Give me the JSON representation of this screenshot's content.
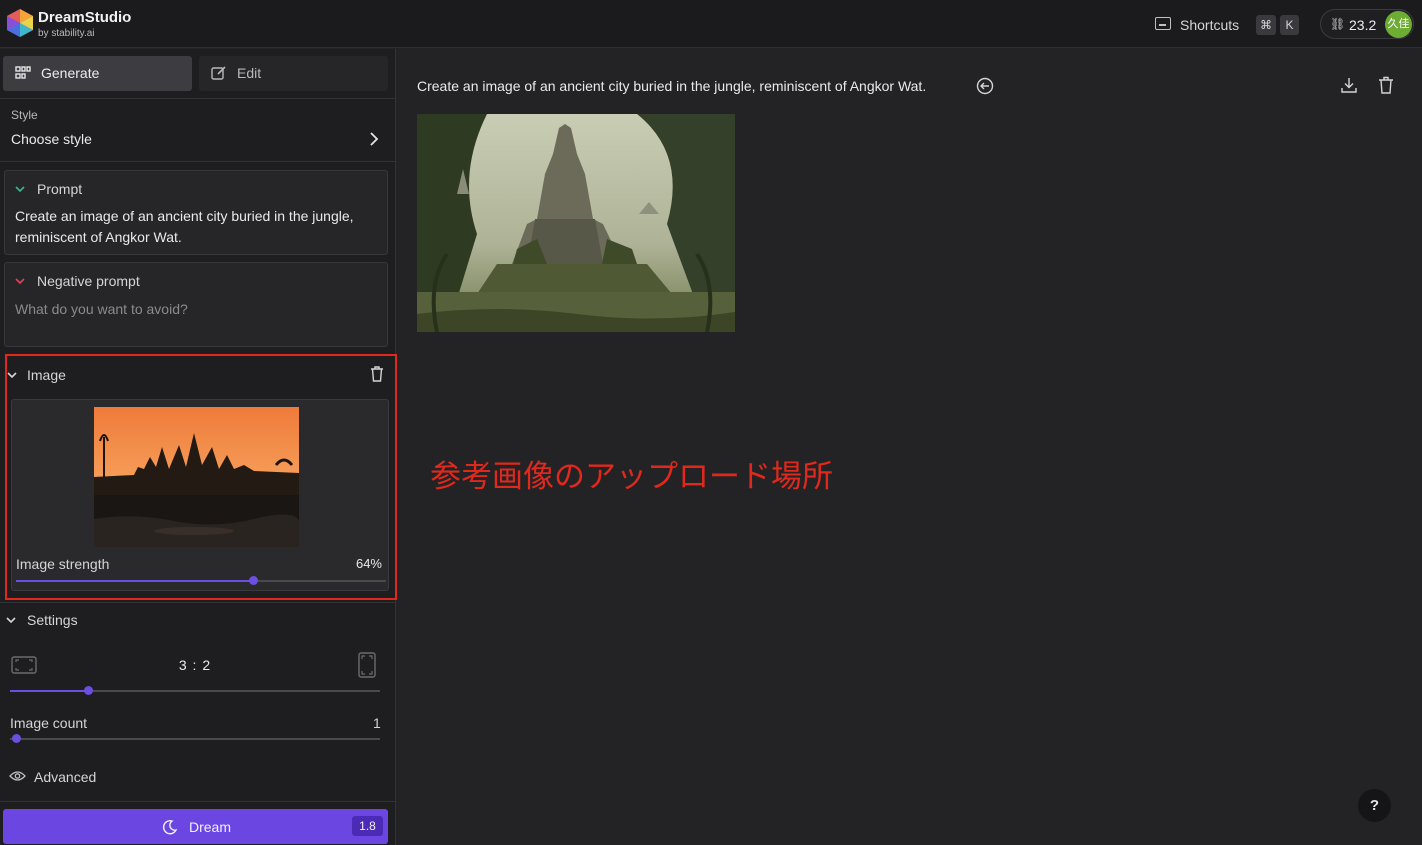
{
  "app": {
    "name": "DreamStudio",
    "subtitle": "by stability.ai"
  },
  "header": {
    "keyboard_icon": "keyboard-icon",
    "shortcuts_label": "Shortcuts",
    "shortcut_keys": [
      "⌘",
      "K"
    ],
    "credits_icon": "credits-icon",
    "credits": "23.2",
    "avatar_text": "久佳"
  },
  "sidebar": {
    "tabs": [
      {
        "label": "Generate",
        "icon": "grid-icon",
        "active": true
      },
      {
        "label": "Edit",
        "icon": "edit-icon",
        "active": false
      }
    ],
    "style": {
      "label": "Style",
      "value": "Choose style"
    },
    "prompt": {
      "title": "Prompt",
      "text": "Create an image of an ancient city buried in the jungle, reminiscent of Angkor Wat."
    },
    "negative_prompt": {
      "title": "Negative prompt",
      "placeholder": "What do you want to avoid?"
    },
    "image": {
      "title": "Image",
      "strength_label": "Image strength",
      "strength_value": "64%",
      "strength_fraction": 0.64
    },
    "settings": {
      "title": "Settings",
      "aspect_ratio": "3 : 2",
      "aspect_fraction": 0.21,
      "image_count_label": "Image count",
      "image_count_value": "1",
      "image_count_fraction": 0.0,
      "advanced_label": "Advanced"
    },
    "dream_button": {
      "label": "Dream",
      "cost": "1.8"
    }
  },
  "main": {
    "prompt_title": "Create an image of an ancient city buried in the jungle, reminiscent of Angkor Wat.",
    "annotation": "参考画像のアップロード場所",
    "help_label": "?"
  },
  "colors": {
    "accent": "#6b46e0",
    "highlight": "#e0281d",
    "avatar": "#6dad34"
  }
}
